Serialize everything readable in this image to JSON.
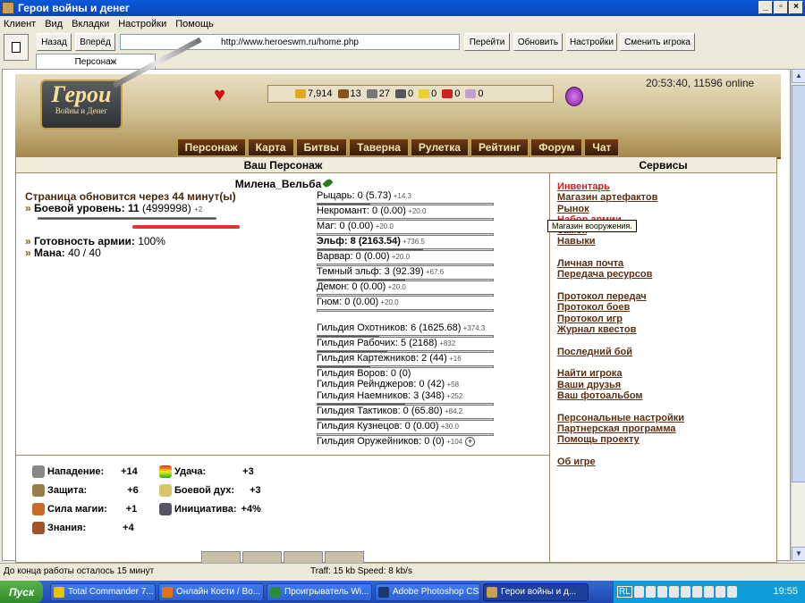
{
  "window": {
    "title": "Герои войны и денег"
  },
  "menu": [
    "Клиент",
    "Вид",
    "Вкладки",
    "Настройки",
    "Помощь"
  ],
  "toolbar": {
    "back": "Назад",
    "forward": "Вперёд",
    "url": "http://www.heroeswm.ru/home.php",
    "go": "Перейти",
    "refresh": "Обновить",
    "settings": "Настройки",
    "change_player": "Сменить игрока"
  },
  "tab": {
    "label": "Персонаж"
  },
  "header": {
    "logo_title": "Герои",
    "logo_subtitle": "Войны и Денег",
    "time_online": "20:53:40, 11596 online",
    "resources": [
      "7,914",
      "13",
      "27",
      "0",
      "0",
      "0",
      "0"
    ],
    "nav": [
      "Персонаж",
      "Карта",
      "Битвы",
      "Таверна",
      "Рулетка",
      "Рейтинг",
      "Форум",
      "Чат"
    ]
  },
  "left": {
    "heading": "Ваш Персонаж",
    "name": "Милена_Вельба",
    "refresh_note": "Страница обновится через 44 минут(ы)",
    "combat_label": "Боевой уровень:",
    "combat_value": "11",
    "combat_exp": "(4999998)",
    "combat_plus": "+2",
    "combat_bar_fraction": 1.0,
    "army_label": "Готовность армии:",
    "army_value": "100%",
    "mana_label": "Мана:",
    "mana_value": "40 / 40"
  },
  "factions": [
    {
      "label": "Рыцарь: 0 (5.73)",
      "plus": "+14.3",
      "fill": 0.3
    },
    {
      "label": "Некромант: 0 (0.00)",
      "plus": "+20.0",
      "fill": 0
    },
    {
      "label": "Маг: 0 (0.00)",
      "plus": "+20.0",
      "fill": 0
    },
    {
      "label": "Эльф: 8 (2163.54)",
      "plus": "+736.5",
      "fill": 0.6,
      "bold": true
    },
    {
      "label": "Варвар: 0 (0.00)",
      "plus": "+20.0",
      "fill": 0
    },
    {
      "label": "Темный эльф: 3 (92.39)",
      "plus": "+67.6",
      "fill": 0.5
    },
    {
      "label": "Демон: 0 (0.00)",
      "plus": "+20.0",
      "fill": 0
    },
    {
      "label": "Гном: 0 (0.00)",
      "plus": "+20.0",
      "fill": 0
    }
  ],
  "guilds": [
    {
      "label": "Гильдия Охотников: 6 (1625.68)",
      "plus": "+374.3",
      "fill": 0.35
    },
    {
      "label": "Гильдия Рабочих: 5 (2168)",
      "plus": "+832",
      "fill": 0.4
    },
    {
      "label": "Гильдия Картежников: 2 (44)",
      "plus": "+16",
      "fill": 0.3
    },
    {
      "label": "Гильдия Воров: 0 (0)",
      "plus": "",
      "fill": null
    },
    {
      "label": "Гильдия Рейнджеров: 0 (42)",
      "plus": "+58",
      "fill": null
    },
    {
      "label": "Гильдия Наемников: 3 (348)",
      "plus": "+252",
      "fill": 0.5
    },
    {
      "label": "Гильдия Тактиков: 0 (65.80)",
      "plus": "+84.2",
      "fill": 0.35
    },
    {
      "label": "Гильдия Кузнецов: 0 (0.00)",
      "plus": "+30.0",
      "fill": 0
    },
    {
      "label": "Гильдия Оружейников: 0 (0)",
      "plus": "+104",
      "fill": null,
      "button": "+"
    }
  ],
  "skills": {
    "attack_label": "Нападение:",
    "attack_value": "+14",
    "defense_label": "Защита:",
    "defense_value": "+6",
    "magic_label": "Сила магии:",
    "magic_value": "+1",
    "knowledge_label": "Знания:",
    "knowledge_value": "+4",
    "luck_label": "Удача:",
    "luck_value": "+3",
    "morale_label": "Боевой дух:",
    "morale_value": "+3",
    "initiative_label": "Инициатива:",
    "initiative_value": "+4%"
  },
  "services": {
    "heading": "Сервисы",
    "inventory": "Инвентарь",
    "artifact_shop": "Магазин артефактов",
    "market": "Рынок",
    "recruit": "Набор армии",
    "castle": "Замок",
    "skills": "Навыки",
    "mail": "Личная почта",
    "transfer": "Передача ресурсов",
    "transfer_log": "Протокол передач",
    "battle_log": "Протокол боев",
    "game_log": "Протокол игр",
    "quest_log": "Журнал квестов",
    "last_battle": "Последний бой",
    "find_player": "Найти игрока",
    "friends": "Ваши друзья",
    "album": "Ваш фотоальбом",
    "personal_settings": "Персональные настройки",
    "partner": "Партнерская программа",
    "help_project": "Помощь проекту",
    "about": "Об игре",
    "tooltip": "Магазин вооружения."
  },
  "statusbar": {
    "left": "До конца работы осталось 15 минут",
    "middle": "Traff: 15 kb Speed: 8 kb/s"
  },
  "taskbar": {
    "start": "Пуск",
    "tasks": [
      "Total Commander 7...",
      "Онлайн Кости / Во...",
      "Проигрыватель Wi...",
      "Adobe Photoshop CS3",
      "Герои войны и д..."
    ],
    "tray_lang": "RL",
    "clock": "19:55"
  }
}
